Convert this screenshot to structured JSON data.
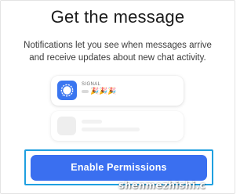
{
  "header": {
    "title": "Get the message"
  },
  "body": {
    "description": "Notifications let you see when messages arrive and receive updates about new chat activity."
  },
  "notification_preview": {
    "app_name": "SIGNAL",
    "emoji_text": "🎉🎉🎉",
    "app_icon_color": "#3a76f0"
  },
  "actions": {
    "enable_label": "Enable Permissions",
    "button_color": "#3a6ff0",
    "highlight_color": "#1fa0e0"
  },
  "watermark": {
    "text": "shenmezhishi.c"
  }
}
